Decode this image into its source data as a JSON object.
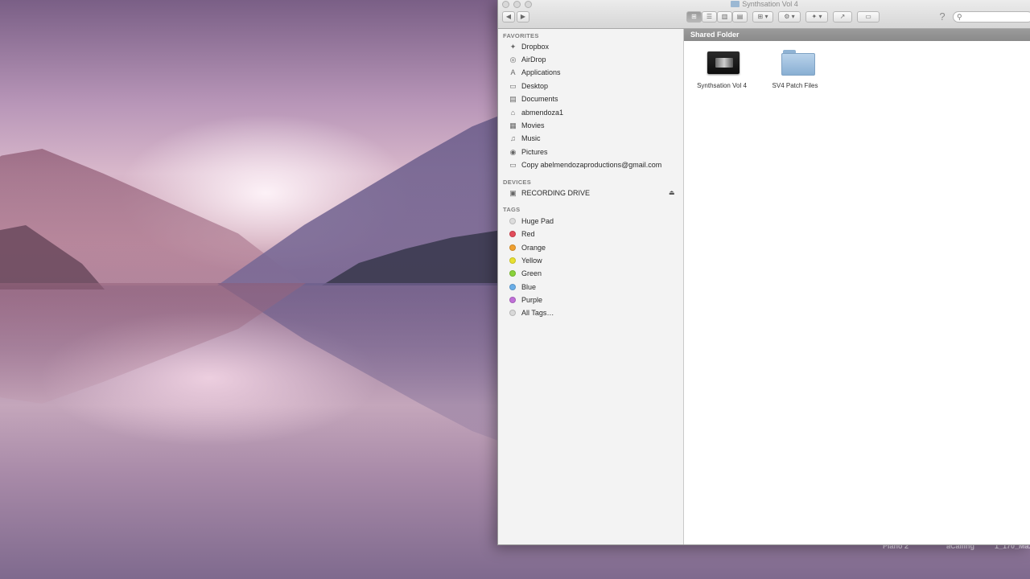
{
  "window": {
    "title": "Synthsation Vol 4"
  },
  "toolbar": {
    "back": "◀",
    "forward": "▶",
    "view_icon": "⊞",
    "view_list": "☰",
    "view_columns": "▥",
    "view_coverflow": "▤",
    "arrange": "⊞ ▾",
    "action": "⚙ ▾",
    "dropbox": "✦ ▾",
    "share": "↗",
    "tags": "▭",
    "help": "?",
    "search_icon": "⚲"
  },
  "sidebar": {
    "favorites_header": "FAVORITES",
    "favorites": [
      {
        "label": "Dropbox",
        "icon": "✦"
      },
      {
        "label": "AirDrop",
        "icon": "◎"
      },
      {
        "label": "Applications",
        "icon": "A"
      },
      {
        "label": "Desktop",
        "icon": "▭"
      },
      {
        "label": "Documents",
        "icon": "▤"
      },
      {
        "label": "abmendoza1",
        "icon": "⌂"
      },
      {
        "label": "Movies",
        "icon": "▦"
      },
      {
        "label": "Music",
        "icon": "♫"
      },
      {
        "label": "Pictures",
        "icon": "◉"
      },
      {
        "label": "Copy abelmendozaproductions@gmail.com",
        "icon": "▭"
      }
    ],
    "devices_header": "DEVICES",
    "devices": [
      {
        "label": "RECORDING DRIVE",
        "icon": "▣",
        "eject": "⏏"
      }
    ],
    "tags_header": "TAGS",
    "tags": [
      {
        "label": "Huge Pad",
        "color": "#dcdcdc"
      },
      {
        "label": "Red",
        "color": "#e24b5a"
      },
      {
        "label": "Orange",
        "color": "#f0a030"
      },
      {
        "label": "Yellow",
        "color": "#e8e030"
      },
      {
        "label": "Green",
        "color": "#8ad23a"
      },
      {
        "label": "Blue",
        "color": "#6aaee8"
      },
      {
        "label": "Purple",
        "color": "#c070d8"
      },
      {
        "label": "All Tags…",
        "color": "#d8d8d8"
      }
    ]
  },
  "content": {
    "path_label": "Shared Folder",
    "items": [
      {
        "label": "Synthsation Vol 4",
        "kind": "app"
      },
      {
        "label": "SV4 Patch Files",
        "kind": "folder"
      }
    ]
  },
  "dock": {
    "labels": [
      "Piano 2",
      "aCalling",
      "1_170_Ma..."
    ]
  }
}
